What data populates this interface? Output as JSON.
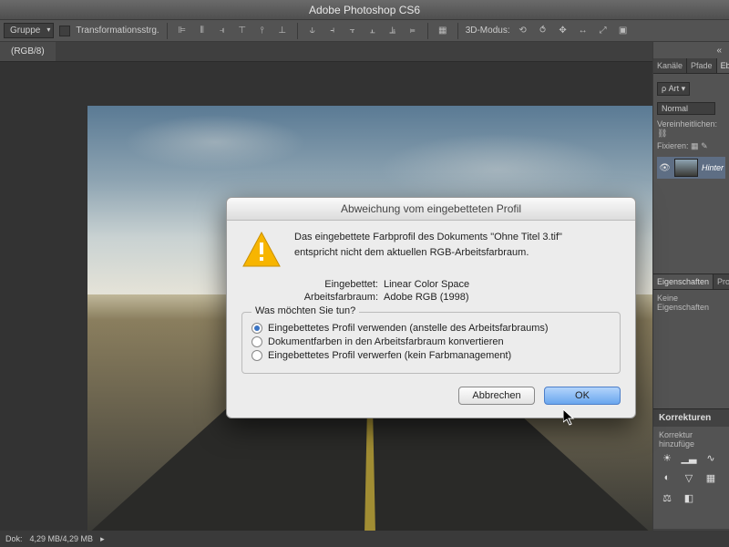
{
  "app": {
    "title": "Adobe Photoshop CS6"
  },
  "options_bar": {
    "group_dropdown": "Gruppe",
    "transform_checkbox_label": "Transformationsstrg.",
    "mode_3d_label": "3D-Modus:"
  },
  "document_tab": "(RGB/8)",
  "panels": {
    "tabs": {
      "kanale": "Kanäle",
      "pfade": "Pfade",
      "ebenen": "Eb"
    },
    "kind_dropdown": "Art",
    "blend_mode": "Normal",
    "unify_label": "Vereinheitlichen:",
    "lock_label": "Fixieren:",
    "layer_name": "Hinter",
    "properties_tab": "Eigenschaften",
    "properties_tab2": "Pro",
    "no_properties": "Keine Eigenschaften",
    "corrections_header": "Korrekturen",
    "corrections_add": "Korrektur hinzufüge"
  },
  "status": {
    "doc_label": "Dok:",
    "doc_size": "4,29 MB/4,29 MB"
  },
  "dialog": {
    "title": "Abweichung vom eingebetteten Profil",
    "message_line1": "Das eingebettete Farbprofil des Dokuments \"Ohne Titel 3.tif\"",
    "message_line2": "entspricht nicht dem aktuellen RGB-Arbeitsfarbraum.",
    "embedded_label": "Eingebettet:",
    "embedded_value": "Linear Color Space",
    "working_label": "Arbeitsfarbraum:",
    "working_value": "Adobe RGB (1998)",
    "question": "Was möchten Sie tun?",
    "option1": "Eingebettetes Profil verwenden (anstelle des Arbeitsfarbraums)",
    "option2": "Dokumentfarben in den Arbeitsfarbraum konvertieren",
    "option3": "Eingebettetes Profil verwerfen (kein Farbmanagement)",
    "cancel": "Abbrechen",
    "ok": "OK"
  }
}
